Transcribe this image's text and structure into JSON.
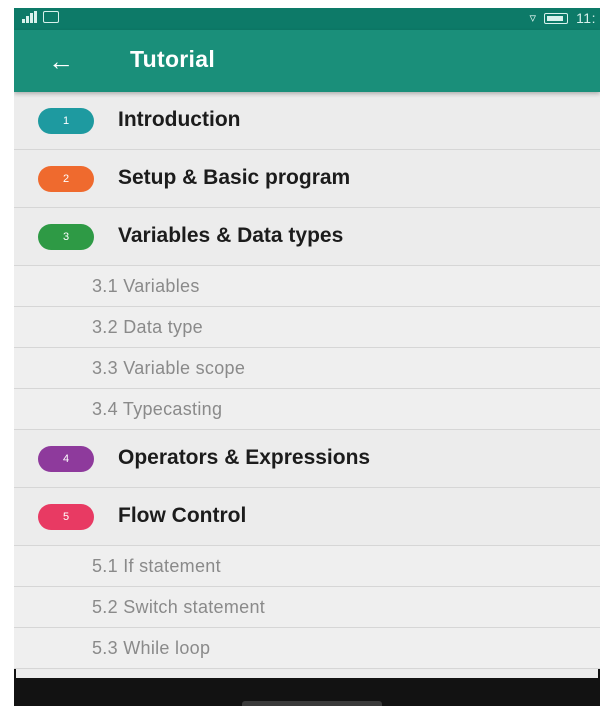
{
  "status_bar": {
    "signal": "signal-icon",
    "notification": "notification-icon",
    "wifi": "wifi-icon",
    "battery": "battery-icon",
    "time": "11:"
  },
  "toolbar": {
    "back_icon": "←",
    "title": "Tutorial",
    "color": "#1a8f7a"
  },
  "chapters": [
    {
      "number": "1",
      "title": "Introduction",
      "color": "#1e9aa0",
      "sections": []
    },
    {
      "number": "2",
      "title": "Setup & Basic program",
      "color": "#ef6a2e",
      "sections": []
    },
    {
      "number": "3",
      "title": "Variables & Data types",
      "color": "#2e9a45",
      "sections": [
        "3.1 Variables",
        "3.2 Data type",
        "3.3 Variable scope",
        "3.4 Typecasting"
      ]
    },
    {
      "number": "4",
      "title": "Operators & Expressions",
      "color": "#8e3a9c",
      "sections": []
    },
    {
      "number": "5",
      "title": "Flow Control",
      "color": "#e83a63",
      "sections": [
        "5.1 If statement",
        "5.2 Switch statement",
        "5.3 While loop"
      ]
    }
  ]
}
